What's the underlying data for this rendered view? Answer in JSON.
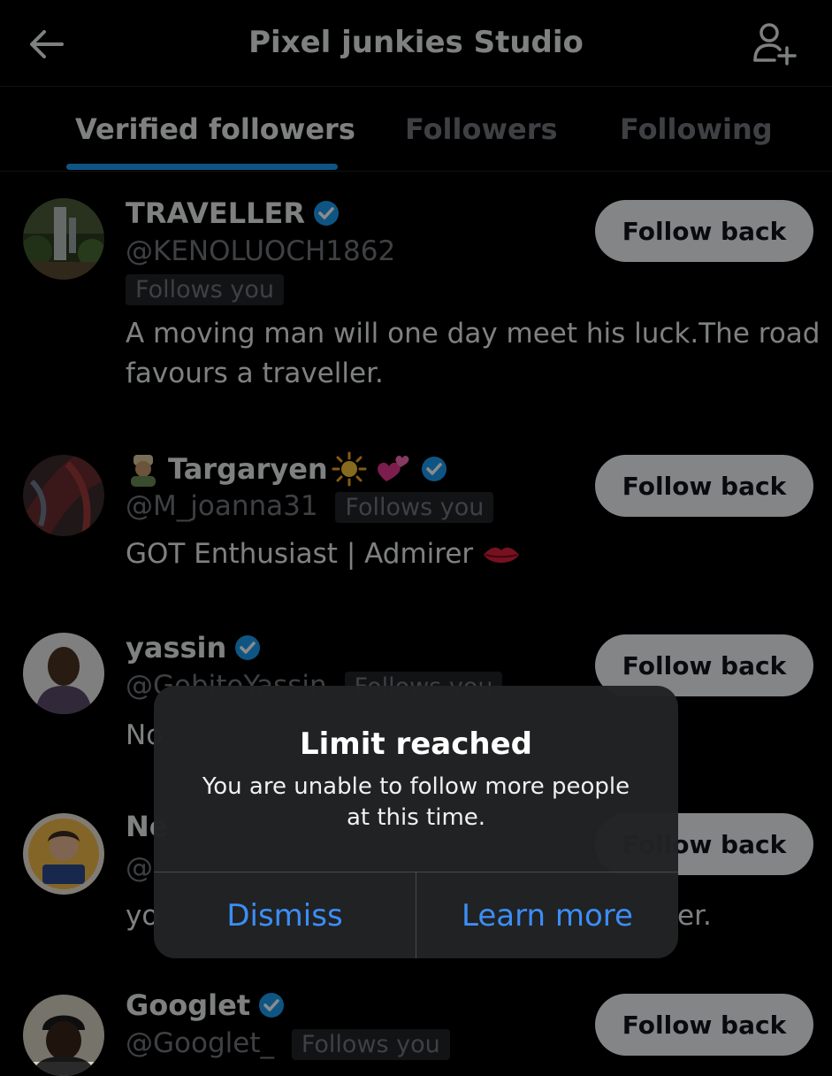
{
  "header": {
    "title": "Pixel junkies Studio",
    "back_icon": "arrow-left-icon",
    "add_icon": "add-person-icon"
  },
  "tabs": [
    {
      "label": "Verified followers",
      "active": true
    },
    {
      "label": "Followers",
      "active": false
    },
    {
      "label": "Following",
      "active": false
    }
  ],
  "accent_color": "#1d9bf0",
  "users": [
    {
      "name": "TRAVELLER",
      "handle": "@KENOLUOCH1862",
      "badge": "Follows you",
      "bio_line1": "A moving man will one day meet his luck.The road",
      "bio_line2": "favours a traveller.",
      "button": "Follow back"
    },
    {
      "name": "Targaryen",
      "handle": "@M_joanna31",
      "badge": "Follows you",
      "bio": "GOT Enthusiast | Admirer",
      "button": "Follow back"
    },
    {
      "name": "yassin",
      "handle": "@GobitoYassin",
      "badge": "Follows you",
      "bio": "No",
      "button": "Follow back"
    },
    {
      "name": "Ne",
      "handle": "@",
      "bio": "yo",
      "bio_tail": "er.",
      "button": "Follow back"
    },
    {
      "name": "Googlet",
      "handle": "@Googlet_",
      "badge": "Follows you",
      "button": "Follow back"
    }
  ],
  "alert": {
    "title": "Limit reached",
    "message_line1": "You are unable to follow more people",
    "message_line2": "at this time.",
    "dismiss": "Dismiss",
    "learn_more": "Learn more",
    "button_color": "#3c8ef7"
  }
}
